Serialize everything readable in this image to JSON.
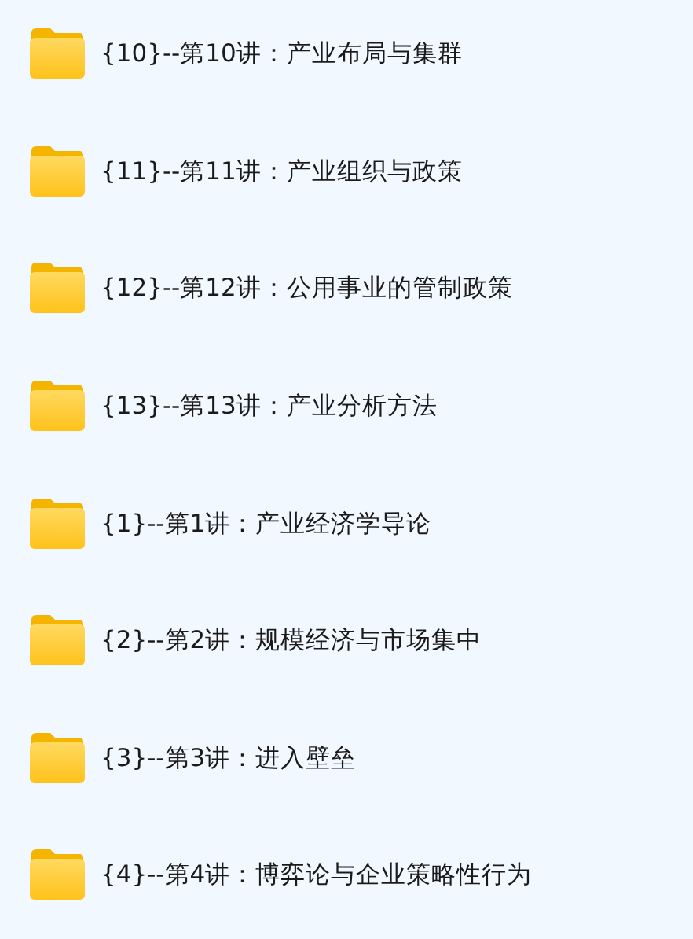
{
  "folders": [
    {
      "name": "{10}--第10讲：产业布局与集群"
    },
    {
      "name": "{11}--第11讲：产业组织与政策"
    },
    {
      "name": "{12}--第12讲：公用事业的管制政策"
    },
    {
      "name": "{13}--第13讲：产业分析方法"
    },
    {
      "name": "{1}--第1讲：产业经济学导论"
    },
    {
      "name": "{2}--第2讲：规模经济与市场集中"
    },
    {
      "name": "{3}--第3讲：进入壁垒"
    },
    {
      "name": "{4}--第4讲：博弈论与企业策略性行为"
    }
  ]
}
